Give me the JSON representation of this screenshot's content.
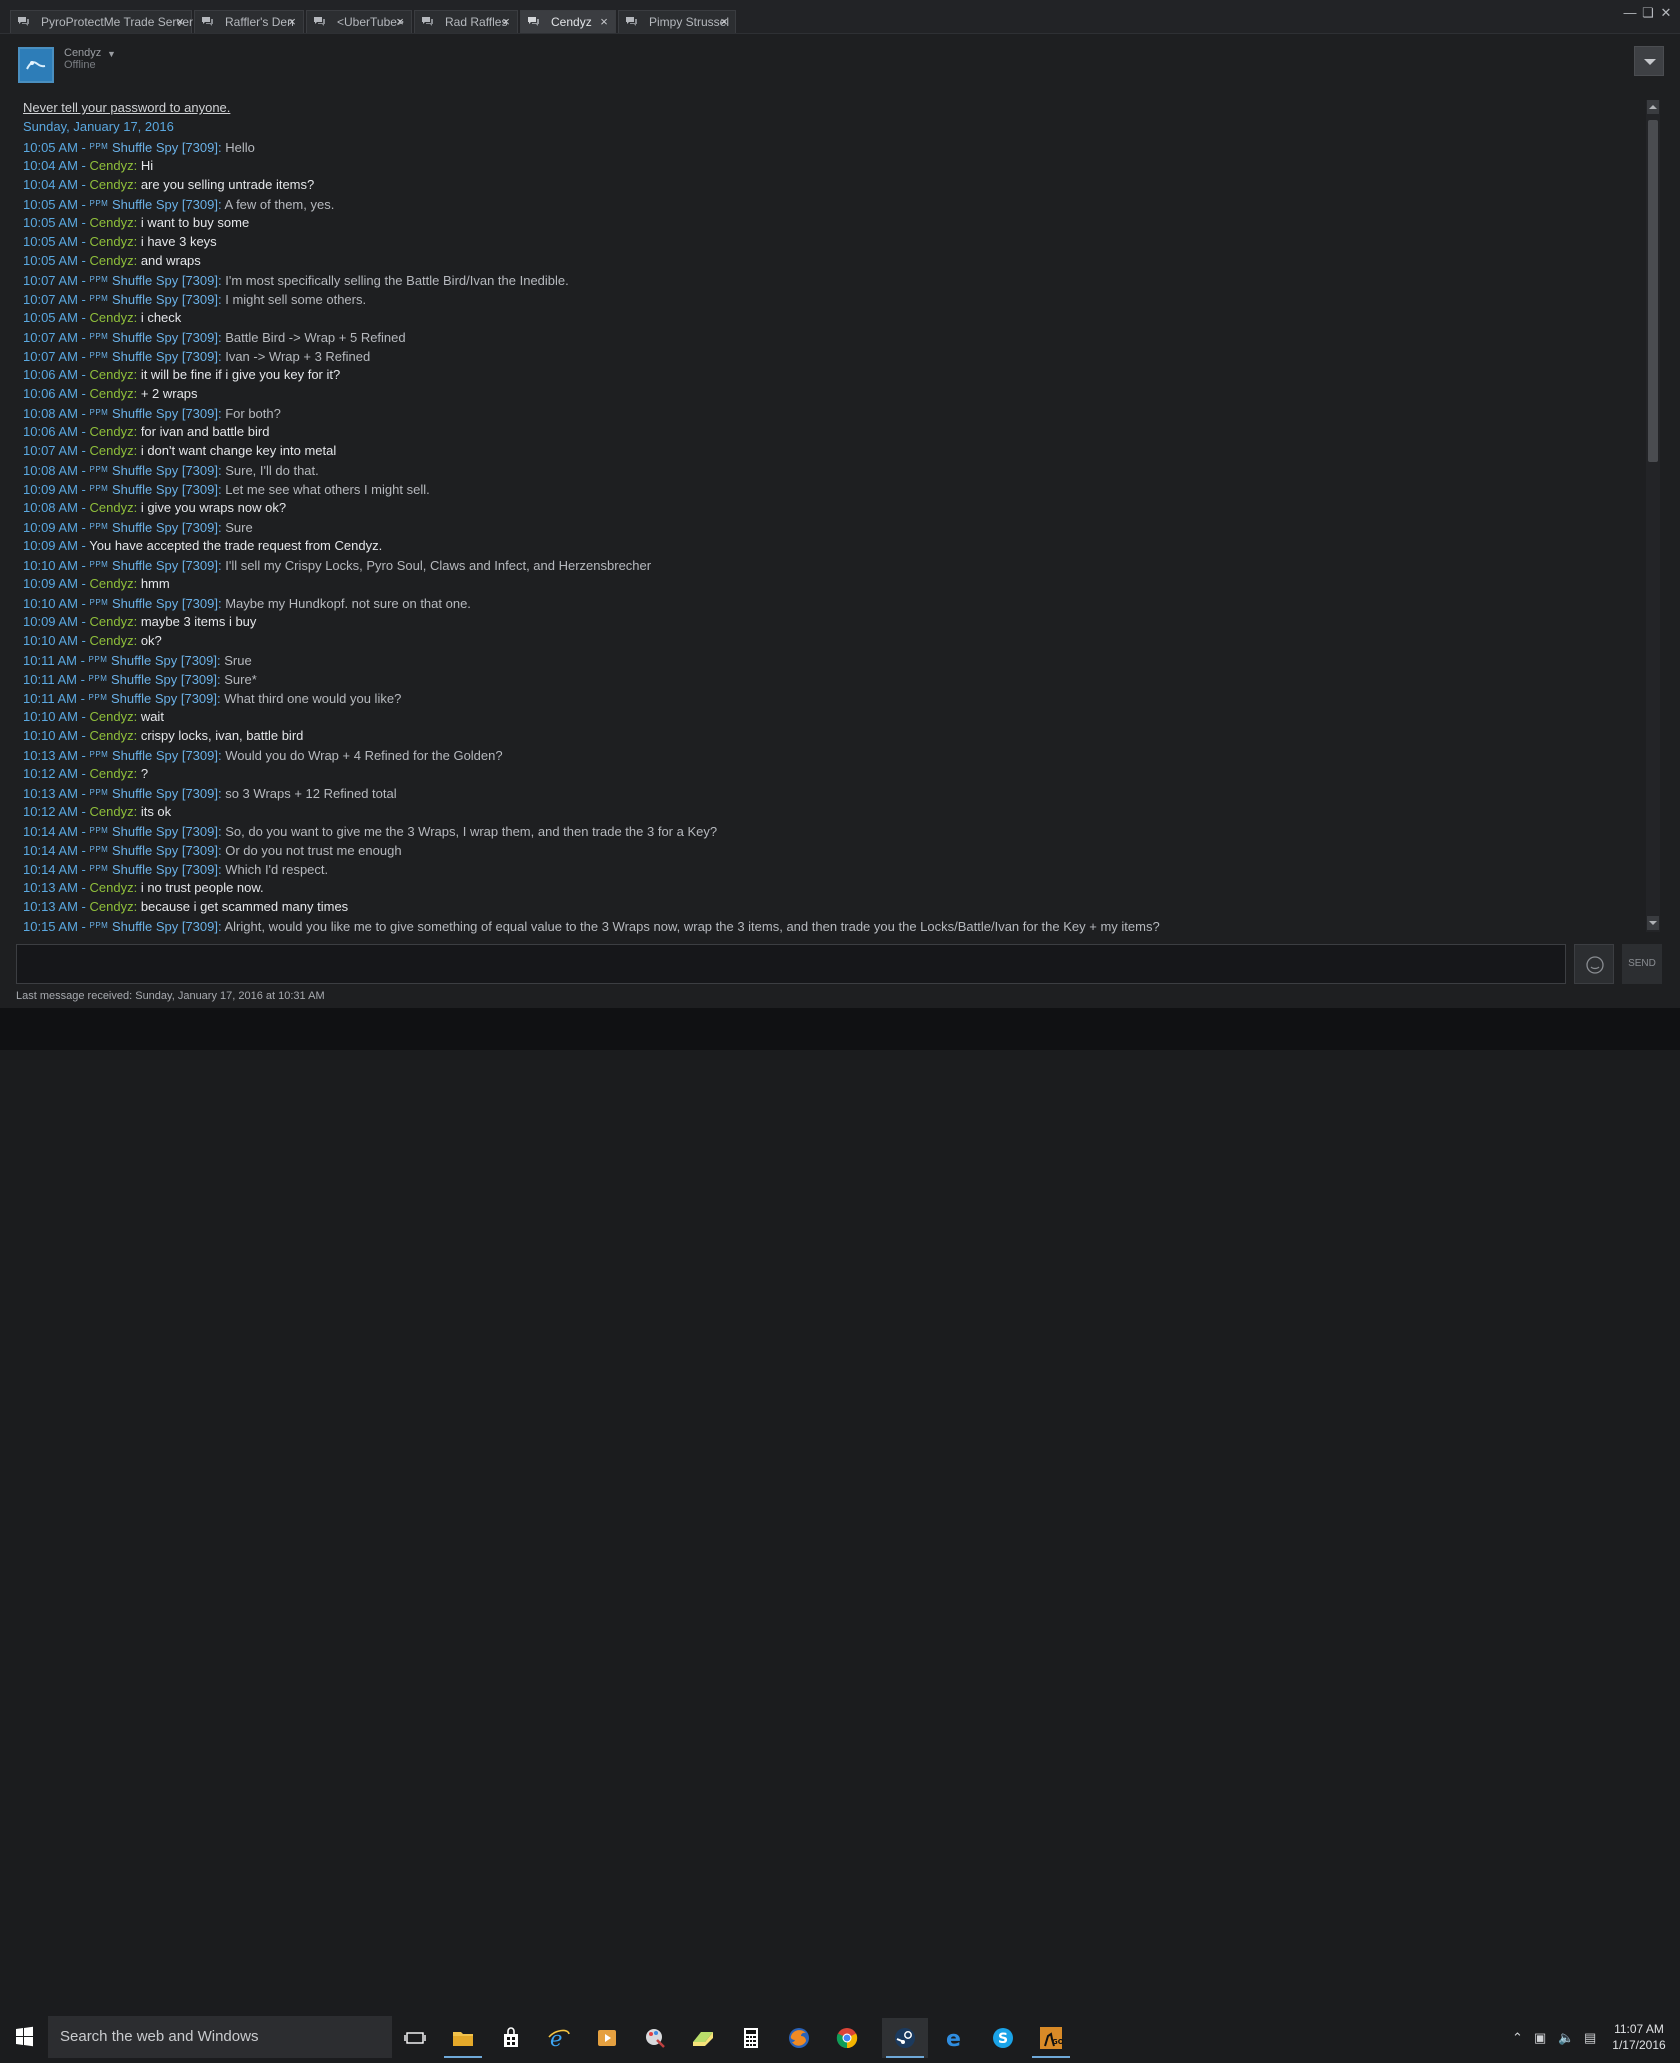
{
  "tabs": [
    {
      "label": "PyroProtectMe Trade Server",
      "active": false
    },
    {
      "label": "Raffler's Den",
      "active": false
    },
    {
      "label": "<UberTube>",
      "active": false
    },
    {
      "label": "Rad Raffles",
      "active": false
    },
    {
      "label": "Cendyz",
      "active": true
    },
    {
      "label": "Pimpy Strussel",
      "active": false
    }
  ],
  "friend": {
    "name": "Cendyz",
    "status": "Offline"
  },
  "warning": "Never tell your password to anyone.",
  "date": "Sunday, January 17, 2016",
  "messages": [
    {
      "time": "10:05 AM",
      "who": "them",
      "name": "Shuffle Spy [7309]",
      "text": "Hello"
    },
    {
      "time": "10:04 AM",
      "who": "me",
      "name": "Cendyz",
      "text": "Hi"
    },
    {
      "time": "10:04 AM",
      "who": "me",
      "name": "Cendyz",
      "text": "are you selling untrade items?"
    },
    {
      "time": "10:05 AM",
      "who": "them",
      "name": "Shuffle Spy [7309]",
      "text": "A few of them, yes."
    },
    {
      "time": "10:05 AM",
      "who": "me",
      "name": "Cendyz",
      "text": "i want to buy some"
    },
    {
      "time": "10:05 AM",
      "who": "me",
      "name": "Cendyz",
      "text": "i have 3 keys"
    },
    {
      "time": "10:05 AM",
      "who": "me",
      "name": "Cendyz",
      "text": "and wraps"
    },
    {
      "time": "10:07 AM",
      "who": "them",
      "name": "Shuffle Spy [7309]",
      "text": "I'm most specifically selling the Battle Bird/Ivan the Inedible."
    },
    {
      "time": "10:07 AM",
      "who": "them",
      "name": "Shuffle Spy [7309]",
      "text": "I might sell some others."
    },
    {
      "time": "10:05 AM",
      "who": "me",
      "name": "Cendyz",
      "text": "i check"
    },
    {
      "time": "10:07 AM",
      "who": "them",
      "name": "Shuffle Spy [7309]",
      "text": "Battle Bird -> Wrap + 5 Refined"
    },
    {
      "time": "10:07 AM",
      "who": "them",
      "name": "Shuffle Spy [7309]",
      "text": "Ivan -> Wrap + 3 Refined"
    },
    {
      "time": "10:06 AM",
      "who": "me",
      "name": "Cendyz",
      "text": "it will be fine if i give you key for it?"
    },
    {
      "time": "10:06 AM",
      "who": "me",
      "name": "Cendyz",
      "text": "+ 2 wraps"
    },
    {
      "time": "10:08 AM",
      "who": "them",
      "name": "Shuffle Spy [7309]",
      "text": "For both?"
    },
    {
      "time": "10:06 AM",
      "who": "me",
      "name": "Cendyz",
      "text": "for ivan and battle bird"
    },
    {
      "time": "10:07 AM",
      "who": "me",
      "name": "Cendyz",
      "text": "i don't want change key into metal"
    },
    {
      "time": "10:08 AM",
      "who": "them",
      "name": "Shuffle Spy [7309]",
      "text": "Sure, I'll do that."
    },
    {
      "time": "10:09 AM",
      "who": "them",
      "name": "Shuffle Spy [7309]",
      "text": "Let me see what others I might sell."
    },
    {
      "time": "10:08 AM",
      "who": "me",
      "name": "Cendyz",
      "text": "i give you wraps now ok?"
    },
    {
      "time": "10:09 AM",
      "who": "them",
      "name": "Shuffle Spy [7309]",
      "text": "Sure"
    },
    {
      "time": "10:09 AM",
      "who": "system",
      "name": "",
      "text": "You have accepted the trade request from Cendyz."
    },
    {
      "time": "10:10 AM",
      "who": "them",
      "name": "Shuffle Spy [7309]",
      "text": "I'll sell my Crispy Locks, Pyro Soul, Claws and Infect, and Herzensbrecher"
    },
    {
      "time": "10:09 AM",
      "who": "me",
      "name": "Cendyz",
      "text": "hmm"
    },
    {
      "time": "10:10 AM",
      "who": "them",
      "name": "Shuffle Spy [7309]",
      "text": "Maybe my Hundkopf. not sure on that one."
    },
    {
      "time": "10:09 AM",
      "who": "me",
      "name": "Cendyz",
      "text": "maybe 3 items i buy"
    },
    {
      "time": "10:10 AM",
      "who": "me",
      "name": "Cendyz",
      "text": "ok?"
    },
    {
      "time": "10:11 AM",
      "who": "them",
      "name": "Shuffle Spy [7309]",
      "text": "Srue"
    },
    {
      "time": "10:11 AM",
      "who": "them",
      "name": "Shuffle Spy [7309]",
      "text": "Sure*"
    },
    {
      "time": "10:11 AM",
      "who": "them",
      "name": "Shuffle Spy [7309]",
      "text": "What third one would you like?"
    },
    {
      "time": "10:10 AM",
      "who": "me",
      "name": "Cendyz",
      "text": "wait"
    },
    {
      "time": "10:10 AM",
      "who": "me",
      "name": "Cendyz",
      "text": "crispy locks, ivan, battle bird"
    },
    {
      "time": "10:13 AM",
      "who": "them",
      "name": "Shuffle Spy [7309]",
      "text": "Would you do Wrap + 4 Refined for the Golden?"
    },
    {
      "time": "10:12 AM",
      "who": "me",
      "name": "Cendyz",
      "text": "?"
    },
    {
      "time": "10:13 AM",
      "who": "them",
      "name": "Shuffle Spy [7309]",
      "text": "so 3 Wraps + 12 Refined total"
    },
    {
      "time": "10:12 AM",
      "who": "me",
      "name": "Cendyz",
      "text": "its ok"
    },
    {
      "time": "10:14 AM",
      "who": "them",
      "name": "Shuffle Spy [7309]",
      "text": "So, do you want to give me the 3 Wraps, I wrap them, and then trade the 3 for a Key?"
    },
    {
      "time": "10:14 AM",
      "who": "them",
      "name": "Shuffle Spy [7309]",
      "text": "Or do you not trust me enough"
    },
    {
      "time": "10:14 AM",
      "who": "them",
      "name": "Shuffle Spy [7309]",
      "text": "Which I'd respect."
    },
    {
      "time": "10:13 AM",
      "who": "me",
      "name": "Cendyz",
      "text": "i no trust people now."
    },
    {
      "time": "10:13 AM",
      "who": "me",
      "name": "Cendyz",
      "text": "because i get scammed many times"
    },
    {
      "time": "10:15 AM",
      "who": "them",
      "name": "Shuffle Spy [7309]",
      "text": "Alright, would you like me to give something of equal value to the 3 Wraps now, wrap the 3 items, and then trade you the Locks/Battle/Ivan for the Key + my items?"
    }
  ],
  "ppm_tag": "PPM",
  "separator": " - ",
  "send_label": "SEND",
  "input_value": "",
  "last_message": "Last message received: Sunday, January 17, 2016 at 10:31 AM",
  "taskbar": {
    "search_placeholder": "Search the web and Windows",
    "apps": [
      "task-view",
      "file-explorer",
      "store",
      "internet-explorer",
      "media-player",
      "paint",
      "notes",
      "calculator",
      "firefox",
      "chrome",
      "steam",
      "edge",
      "skype",
      "csgo"
    ],
    "time": "11:07 AM",
    "date": "1/17/2016"
  },
  "colors": {
    "accent": "#5aa8e0",
    "me": "#8fbf3b",
    "them": "#6ab0e6"
  }
}
